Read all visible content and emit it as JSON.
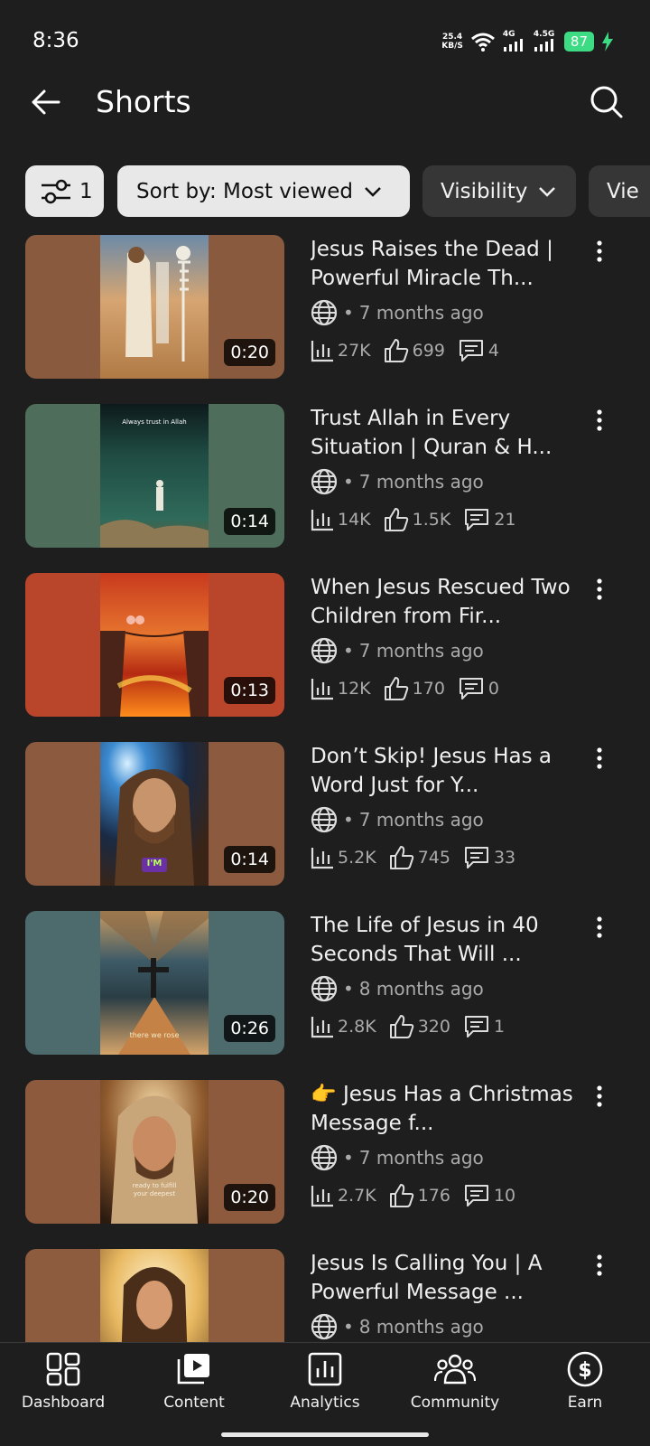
{
  "status_bar": {
    "time": "8:36",
    "net_speed_value": "25.4",
    "net_speed_unit": "KB/S",
    "signal1_label": "4G",
    "signal2_label": "4.5G",
    "battery": "87"
  },
  "header": {
    "title": "Shorts"
  },
  "filters": {
    "filter_count": "1",
    "sort_label": "Sort by: Most viewed",
    "visibility_label": "Visibility",
    "views_label": "Vie"
  },
  "videos": [
    {
      "title": "Jesus Raises the Dead | Powerful Miracle Th...",
      "duration": "0:20",
      "age": "7 months ago",
      "views": "27K",
      "likes": "699",
      "comments": "4"
    },
    {
      "title": "Trust Allah in Every Situation | Quran & H...",
      "duration": "0:14",
      "age": "7 months ago",
      "views": "14K",
      "likes": "1.5K",
      "comments": "21",
      "overlay_text": "Always trust in Allah"
    },
    {
      "title": "When Jesus Rescued Two Children from Fir...",
      "duration": "0:13",
      "age": "7 months ago",
      "views": "12K",
      "likes": "170",
      "comments": "0"
    },
    {
      "title": "Don’t Skip! Jesus Has a Word Just for Y...",
      "duration": "0:14",
      "age": "7 months ago",
      "views": "5.2K",
      "likes": "745",
      "comments": "33",
      "overlay_text": "I'M"
    },
    {
      "title": "The Life of Jesus in 40 Seconds That Will ...",
      "duration": "0:26",
      "age": "8 months ago",
      "views": "2.8K",
      "likes": "320",
      "comments": "1",
      "overlay_text": "there we rose"
    },
    {
      "title": "👉 Jesus Has a Christmas Message f...",
      "duration": "0:20",
      "age": "7 months ago",
      "views": "2.7K",
      "likes": "176",
      "comments": "10",
      "overlay_text": "ready to fulfill your deepest"
    },
    {
      "title": "Jesus Is Calling You | A Powerful Message ...",
      "age": "8 months ago"
    }
  ],
  "thumb_colors": [
    "#8a5a3e",
    "#4f6d5b",
    "#b9452b",
    "#8b5a3f",
    "#4d6b6c",
    "#8e5a3e",
    "#8d5b3d"
  ],
  "nav": {
    "dashboard": "Dashboard",
    "content": "Content",
    "analytics": "Analytics",
    "community": "Community",
    "earn": "Earn"
  }
}
